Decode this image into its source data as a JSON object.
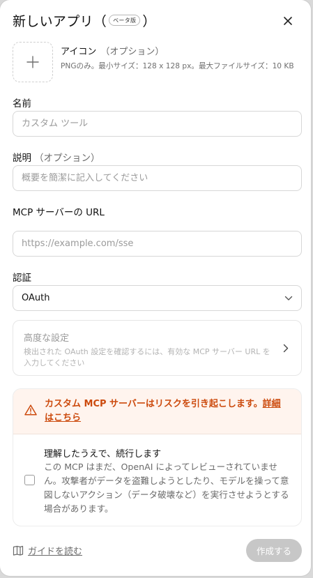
{
  "dialog": {
    "title": "新しいアプリ（",
    "title_end": "）",
    "beta_badge": "ベータ版"
  },
  "icon_upload": {
    "label": "アイコン",
    "optional": "（オプション）",
    "help": "PNGのみ。最小サイズ：128 x 128 px。最大ファイルサイズ：10 KB"
  },
  "name_field": {
    "label": "名前",
    "placeholder": "カスタム ツール",
    "value": ""
  },
  "description_field": {
    "label": "説明",
    "optional": "（オプション）",
    "placeholder": "概要を簡潔に記入してください",
    "value": ""
  },
  "mcp_url_field": {
    "label": "MCP サーバーの URL",
    "placeholder": "https://example.com/sse",
    "value": ""
  },
  "auth": {
    "label": "認証",
    "selected": "OAuth"
  },
  "advanced": {
    "title": "高度な設定",
    "description": "検出された OAuth 設定を確認するには、有効な MCP サーバー URL を入力してください"
  },
  "warning": {
    "text": "カスタム MCP サーバーはリスクを引き起こします。",
    "link": "詳細はこちら",
    "color": "#cc4a0d"
  },
  "acknowledge": {
    "title": "理解したうえで、続行します",
    "description": "この MCP はまだ、OpenAI によってレビューされていません。攻撃者がデータを盗難しようとしたり、モデルを操って意図しないアクション（データ破壊など）を実行させようとする場合があります。",
    "checked": false
  },
  "footer": {
    "guide_link": "ガイドを読む",
    "create_button": "作成する"
  },
  "icons": {
    "close": "close-icon",
    "add": "plus-icon",
    "chevron_down": "chevron-down-icon",
    "chevron_right": "chevron-right-icon",
    "warning": "warning-icon",
    "book": "book-icon"
  }
}
